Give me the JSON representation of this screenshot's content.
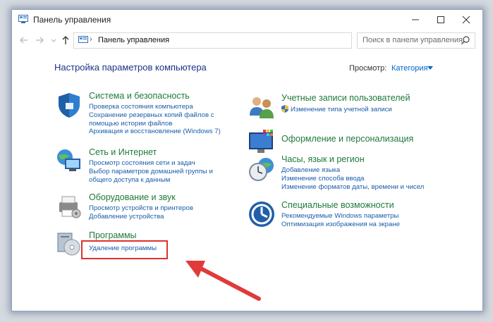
{
  "window": {
    "title": "Панель управления"
  },
  "addressbar": {
    "path": "Панель управления",
    "search_placeholder": "Поиск в панели управления"
  },
  "main": {
    "heading": "Настройка параметров компьютера",
    "view_by_label": "Просмотр:",
    "view_by_value": "Категория"
  },
  "categories": {
    "security": {
      "title": "Система и безопасность",
      "links": [
        "Проверка состояния компьютера",
        "Сохранение резервных копий файлов с",
        "помощью истории файлов",
        "Архивация и восстановление (Windows 7)"
      ],
      "icon": "shield-icon"
    },
    "network": {
      "title": "Сеть и Интернет",
      "links": [
        "Просмотр состояния сети и задач",
        "Выбор параметров домашней группы и",
        "общего доступа к данным"
      ],
      "icon": "network-globe-icon"
    },
    "hardware": {
      "title": "Оборудование и звук",
      "links": [
        "Просмотр устройств и принтеров",
        "Добавление устройства"
      ],
      "icon": "printer-icon"
    },
    "programs": {
      "title": "Программы",
      "links": [
        "Удаление программы"
      ],
      "icon": "programs-disc-icon"
    },
    "accounts": {
      "title": "Учетные записи пользователей",
      "links": [
        "Изменение типа учетной записи"
      ],
      "icon": "users-icon"
    },
    "appearance": {
      "title": "Оформление и персонализация",
      "links": [],
      "icon": "monitor-palette-icon"
    },
    "clock": {
      "title": "Часы, язык и регион",
      "links": [
        "Добавление языка",
        "Изменение способа ввода",
        "Изменение форматов даты, времени и чисел"
      ],
      "icon": "clock-globe-icon"
    },
    "ease": {
      "title": "Специальные возможности",
      "links": [
        "Рекомендуемые Windows параметры",
        "Оптимизация изображения на экране"
      ],
      "icon": "ease-of-access-icon"
    }
  },
  "colors": {
    "category_title": "#1e7a3a",
    "link": "#1a5dab",
    "heading": "#1e3287",
    "highlight": "#e03030"
  }
}
